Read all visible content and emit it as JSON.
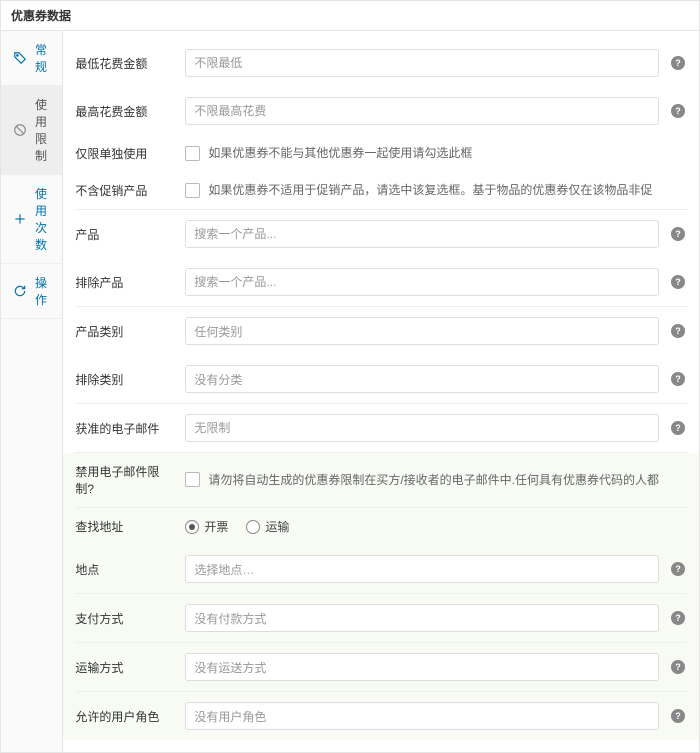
{
  "panel_title": "优惠券数据",
  "sidebar": {
    "items": [
      {
        "label": "常规",
        "icon": "tag-icon"
      },
      {
        "label": "使用限制",
        "icon": "ban-icon"
      },
      {
        "label": "使用次数",
        "icon": "plus-icon"
      },
      {
        "label": "操作",
        "icon": "refresh-icon"
      }
    ]
  },
  "fields": {
    "min_spend": {
      "label": "最低花费金额",
      "placeholder": "不限最低"
    },
    "max_spend": {
      "label": "最高花费金额",
      "placeholder": "不限最高花费"
    },
    "individual_use": {
      "label": "仅限单独使用",
      "desc": "如果优惠券不能与其他优惠券一起使用请勾选此框"
    },
    "exclude_sale": {
      "label": "不含促销产品",
      "desc": "如果优惠券不适用于促销产品，请选中该复选框。基于物品的优惠券仅在该物品非促"
    },
    "products": {
      "label": "产品",
      "placeholder": "搜索一个产品..."
    },
    "exclude_products": {
      "label": "排除产品",
      "placeholder": "搜索一个产品..."
    },
    "categories": {
      "label": "产品类别",
      "placeholder": "任何类别"
    },
    "exclude_categories": {
      "label": "排除类别",
      "placeholder": "没有分类"
    },
    "allowed_emails": {
      "label": "获准的电子邮件",
      "placeholder": "无限制"
    },
    "email_restrict": {
      "label": "禁用电子邮件限制?",
      "desc": "请勿将自动生成的优惠券限制在买方/接收者的电子邮件中.任何具有优惠券代码的人都"
    },
    "address_type": {
      "label": "查找地址",
      "opt1": "开票",
      "opt2": "运输"
    },
    "location": {
      "label": "地点",
      "placeholder": "选择地点…"
    },
    "payment": {
      "label": "支付方式",
      "placeholder": "没有付款方式"
    },
    "shipping": {
      "label": "运输方式",
      "placeholder": "没有运送方式"
    },
    "roles": {
      "label": "允许的用户角色",
      "placeholder": "没有用户角色"
    }
  }
}
